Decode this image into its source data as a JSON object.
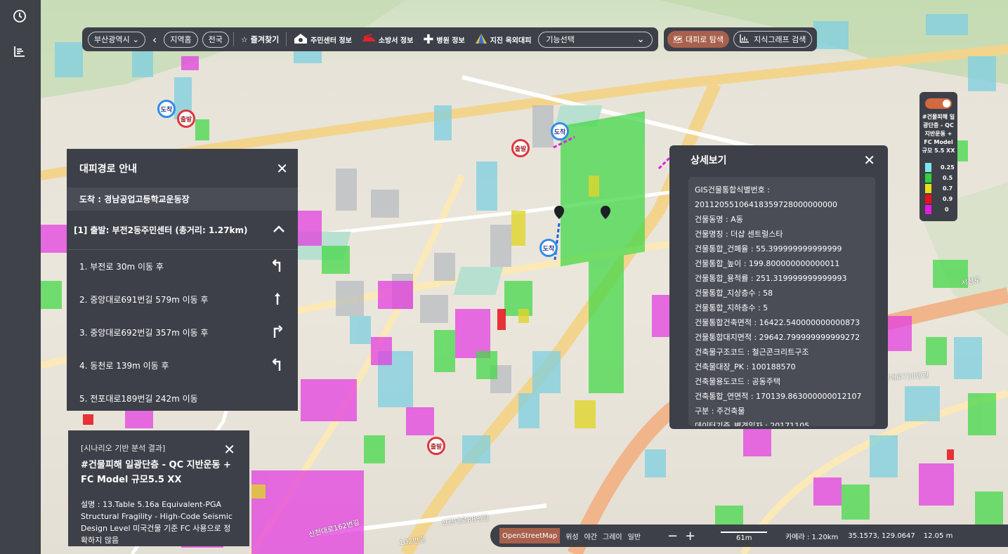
{
  "toolbar": {
    "region": "부산광역시",
    "local_btn": "지역홈",
    "national_btn": "전국",
    "favorites": "즐겨찾기",
    "shelter_info": "주민센터 정보",
    "fire_info": "소방서 정보",
    "hospital_info": "병원 정보",
    "quake_info": "지진 옥외대피",
    "feature_select": "기능선택",
    "evac_search": "대피로 탐색",
    "kg_search": "지식그래프 검색"
  },
  "route": {
    "title": "대피경로 안내",
    "destination": "도착 : 경남공업고등학교운동장",
    "departure": "[1] 출발: 부전2동주민센터 (총거리: 1.27km)",
    "steps": [
      {
        "text": "1. 부전로 30m 이동 후",
        "icon": "turn-left-icon"
      },
      {
        "text": "2. 중앙대로691번길 579m 이동 후",
        "icon": "straight-icon"
      },
      {
        "text": "3. 중앙대로692번길 357m 이동 후",
        "icon": "turn-right-icon"
      },
      {
        "text": "4. 동천로 139m 이동 후",
        "icon": "turn-left-icon"
      },
      {
        "text": "5. 전포대로189번길 242m 이동",
        "icon": ""
      }
    ]
  },
  "detail": {
    "title": "상세보기",
    "rows": [
      "GIS건물통합식별번호 :",
      "20112055106418359728000000000",
      "건물동명 : A동",
      "건물명칭 : 더샵 센트럴스타",
      "건물통합_건폐율 : 55.399999999999999",
      "건물통합_높이 : 199.800000000000011",
      "건물통합_용적률 : 251.319999999999993",
      "건물통합_지상층수 : 58",
      "건물통합_지하층수 : 5",
      "건물통합건축면적 : 16422.540000000000873",
      "건물통합대지면적 : 29642.799999999999272",
      "건축물구조코드 : 철근콘크리트구조",
      "건축물대장_PK : 100188570",
      "건축물용도코드 : 공동주택",
      "건축통합_연면적 : 170139.863000000012107",
      "구분 : 주건축물",
      "데이터기준_변경일자 : 20171105"
    ]
  },
  "scenario": {
    "subtitle": "[시나리오 기반 분석 결과]",
    "title": "#건물피해 일광단층 - QC 지반운동 + FC Model 규모5.5 XX",
    "description": "설명 : 13.Table 5.16a Equivalent-PGA Structural Fragility - High-Code Seismic Design Level 미국건물 기준 FC 사용으로 정확하지 않음"
  },
  "legend": {
    "title": "#건물피해 일광단층 - QC 지반운동 + FC Model 규모 5.5 XX",
    "items": [
      {
        "value": "0.25",
        "color": "#7fe6f0"
      },
      {
        "value": "0.5",
        "color": "#2fd33a"
      },
      {
        "value": "0.7",
        "color": "#e6e21a"
      },
      {
        "value": "0.9",
        "color": "#e8121b"
      },
      {
        "value": "0",
        "color": "#e61ae0"
      }
    ]
  },
  "bottom": {
    "osm": "OpenStreetMap",
    "layers": [
      "위성",
      "야간",
      "그레이",
      "일반"
    ],
    "zoom_out": "−",
    "zoom_in": "+",
    "scale": "61m",
    "camera": "카메라 : 1.20km",
    "coords": "35.1573, 129.0647",
    "elevation": "12.05 m"
  },
  "map": {
    "markers": {
      "arrive": "도착",
      "depart": "출발"
    },
    "road_labels": [
      "신천대로162번길",
      "102번길",
      "신천대로88번길",
      "중앙대로730번길",
      "서전로"
    ]
  }
}
